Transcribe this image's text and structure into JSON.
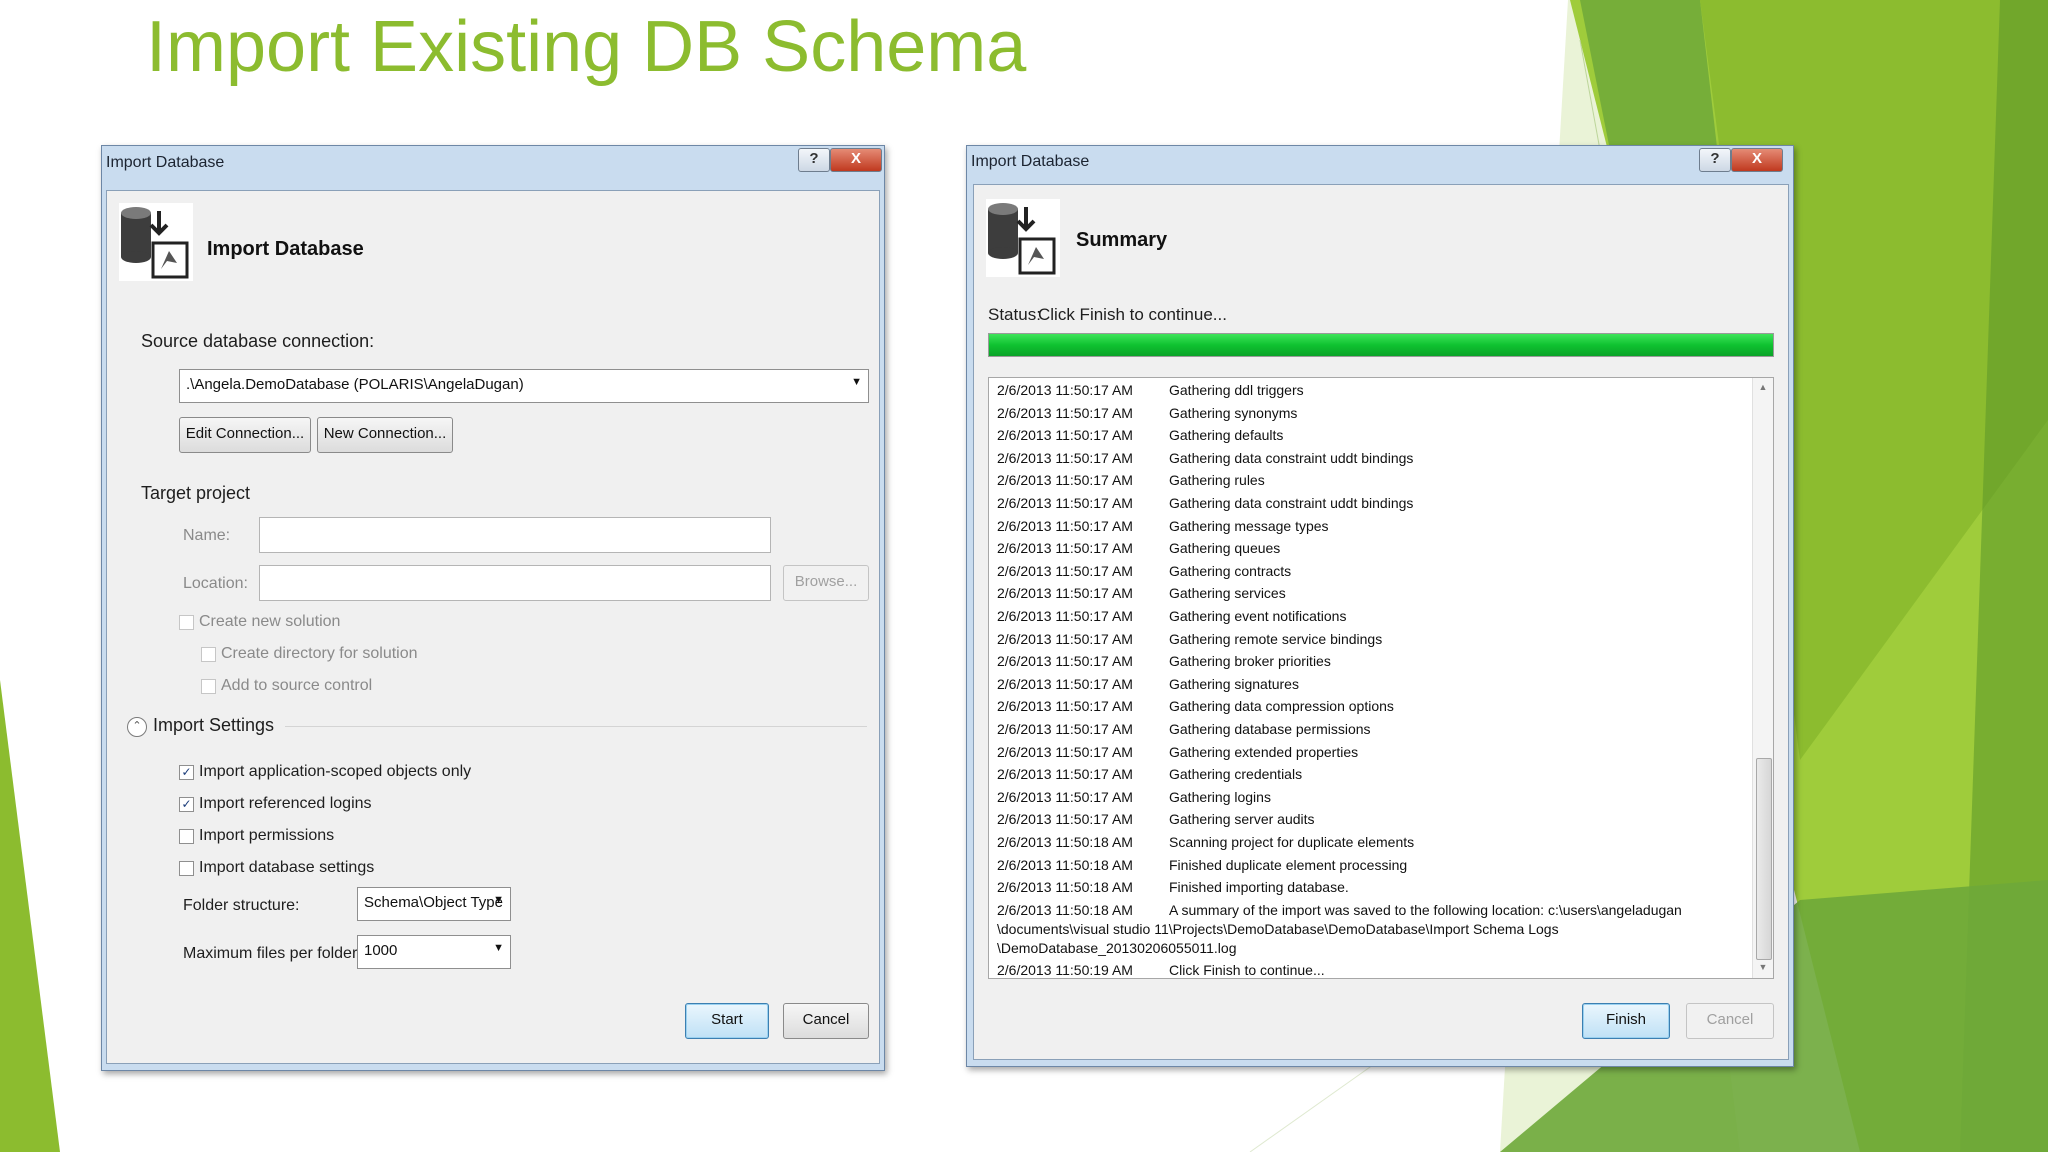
{
  "slide": {
    "title": "Import Existing DB Schema",
    "colors": {
      "title": "#8cbc2f",
      "accent_light": "#9fcc3b",
      "accent_dark": "#5f9a2a"
    }
  },
  "left_dialog": {
    "title": "Import Database",
    "help_label": "?",
    "close_label": "X",
    "header": {
      "title": "Import Database",
      "icon": "database-import-icon"
    },
    "source_label": "Source database connection:",
    "source_value": ".\\Angela.DemoDatabase (POLARIS\\AngelaDugan)",
    "edit_connection": "Edit Connection...",
    "new_connection": "New Connection...",
    "target_project_label": "Target project",
    "name_label": "Name:",
    "name_value": "",
    "location_label": "Location:",
    "location_value": "",
    "browse": "Browse...",
    "create_new_solution": "Create new solution",
    "create_directory": "Create directory for solution",
    "add_source_control": "Add to source control",
    "import_settings": "Import Settings",
    "options": [
      {
        "label": "Import application-scoped objects only",
        "checked": true
      },
      {
        "label": "Import referenced logins",
        "checked": true
      },
      {
        "label": "Import permissions",
        "checked": false
      },
      {
        "label": "Import database settings",
        "checked": false
      }
    ],
    "folder_structure_label": "Folder structure:",
    "folder_structure_value": "Schema\\Object Type",
    "max_files_label": "Maximum files per folder:",
    "max_files_value": "1000",
    "start": "Start",
    "cancel": "Cancel"
  },
  "right_dialog": {
    "title": "Import Database",
    "help_label": "?",
    "close_label": "X",
    "header": {
      "title": "Summary",
      "icon": "database-import-icon"
    },
    "status_label": "Status:",
    "status_value": "Click Finish to continue...",
    "progress": 1.0,
    "log": [
      {
        "ts": "2/6/2013 11:50:17 AM",
        "msg": "Gathering ddl triggers"
      },
      {
        "ts": "2/6/2013 11:50:17 AM",
        "msg": "Gathering synonyms"
      },
      {
        "ts": "2/6/2013 11:50:17 AM",
        "msg": "Gathering defaults"
      },
      {
        "ts": "2/6/2013 11:50:17 AM",
        "msg": "Gathering data constraint uddt bindings"
      },
      {
        "ts": "2/6/2013 11:50:17 AM",
        "msg": "Gathering rules"
      },
      {
        "ts": "2/6/2013 11:50:17 AM",
        "msg": "Gathering data constraint uddt bindings"
      },
      {
        "ts": "2/6/2013 11:50:17 AM",
        "msg": "Gathering message types"
      },
      {
        "ts": "2/6/2013 11:50:17 AM",
        "msg": "Gathering queues"
      },
      {
        "ts": "2/6/2013 11:50:17 AM",
        "msg": "Gathering contracts"
      },
      {
        "ts": "2/6/2013 11:50:17 AM",
        "msg": "Gathering services"
      },
      {
        "ts": "2/6/2013 11:50:17 AM",
        "msg": "Gathering event notifications"
      },
      {
        "ts": "2/6/2013 11:50:17 AM",
        "msg": "Gathering remote service bindings"
      },
      {
        "ts": "2/6/2013 11:50:17 AM",
        "msg": "Gathering broker priorities"
      },
      {
        "ts": "2/6/2013 11:50:17 AM",
        "msg": "Gathering signatures"
      },
      {
        "ts": "2/6/2013 11:50:17 AM",
        "msg": "Gathering data compression options"
      },
      {
        "ts": "2/6/2013 11:50:17 AM",
        "msg": "Gathering database permissions"
      },
      {
        "ts": "2/6/2013 11:50:17 AM",
        "msg": "Gathering extended properties"
      },
      {
        "ts": "2/6/2013 11:50:17 AM",
        "msg": "Gathering credentials"
      },
      {
        "ts": "2/6/2013 11:50:17 AM",
        "msg": "Gathering logins"
      },
      {
        "ts": "2/6/2013 11:50:17 AM",
        "msg": "Gathering server audits"
      },
      {
        "ts": "2/6/2013 11:50:18 AM",
        "msg": "Scanning project for duplicate elements"
      },
      {
        "ts": "2/6/2013 11:50:18 AM",
        "msg": "Finished duplicate element processing"
      },
      {
        "ts": "2/6/2013 11:50:18 AM",
        "msg": "Finished importing database."
      },
      {
        "ts": "2/6/2013 11:50:18 AM",
        "msg": "A summary of the import was saved to the following location: c:\\users\\angeladugan"
      }
    ],
    "log_continuation": [
      "\\documents\\visual studio 11\\Projects\\DemoDatabase\\DemoDatabase\\Import Schema Logs",
      "\\DemoDatabase_20130206055011.log"
    ],
    "log_last": {
      "ts": "2/6/2013 11:50:19 AM",
      "msg": "Click Finish to continue..."
    },
    "finish": "Finish",
    "cancel": "Cancel"
  }
}
